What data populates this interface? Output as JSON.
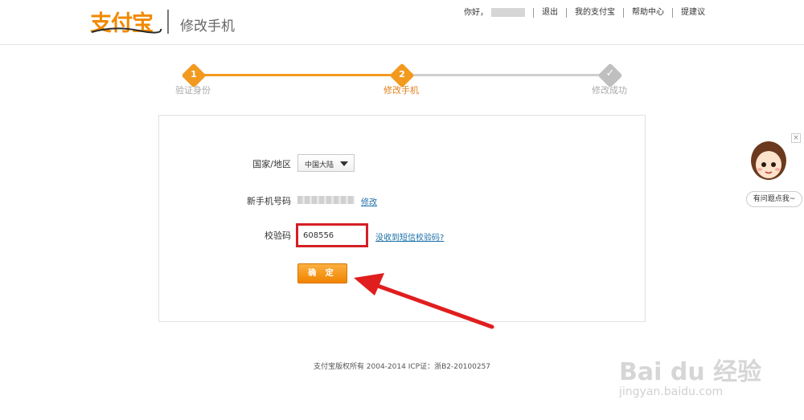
{
  "header": {
    "logo_text": "支付宝",
    "page_title": "修改手机",
    "nav": {
      "greeting": "你好，",
      "logout": "退出",
      "my_alipay": "我的支付宝",
      "help_center": "帮助中心",
      "feedback": "提建议"
    }
  },
  "steps": [
    {
      "number": "1",
      "label": "验证身份",
      "state": "done"
    },
    {
      "number": "2",
      "label": "修改手机",
      "state": "current"
    },
    {
      "number": "✓",
      "label": "修改成功",
      "state": "pending"
    }
  ],
  "form": {
    "region_label": "国家/地区",
    "region_value": "中国大陆",
    "new_phone_label": "新手机号码",
    "modify_link": "修改",
    "code_label": "校验码",
    "code_value": "608556",
    "no_sms_link": "没收到短信校验码?",
    "confirm_button": "确 定"
  },
  "footer": {
    "copyright": "支付宝版权所有 2004-2014 ICP证：浙B2-20100257"
  },
  "help_widget": {
    "close": "×",
    "bubble_text": "有问题点我~"
  },
  "watermark": {
    "main": "Bai du 经验",
    "sub": "jingyan.baidu.com"
  },
  "colors": {
    "accent": "#f29a1f",
    "link": "#1a6fa8",
    "highlight": "#d41f26",
    "pending": "#bfbfbf"
  }
}
